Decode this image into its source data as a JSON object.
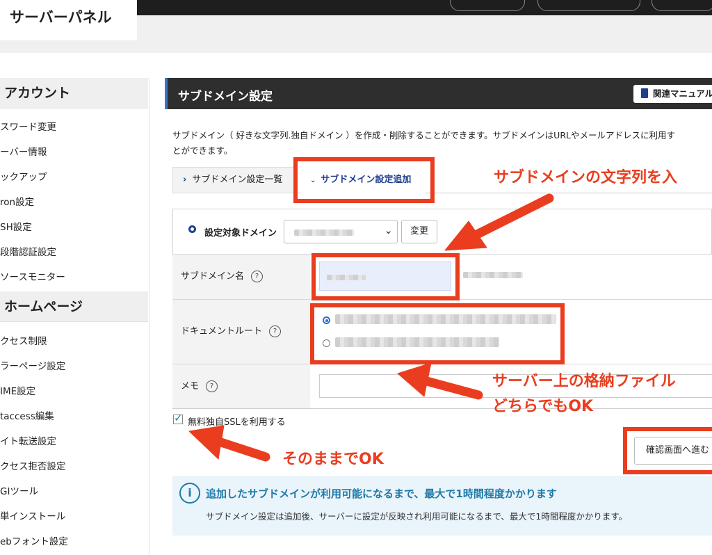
{
  "header": {
    "logo": "サーバーパネル"
  },
  "sidebar": {
    "sections": [
      {
        "title": "アカウント",
        "items": [
          "スワード変更",
          "ーバー情報",
          "ックアップ",
          "ron設定",
          "SH設定",
          "段階認証設定",
          "ソースモニター"
        ]
      },
      {
        "title": "ホームページ",
        "items": [
          "クセス制限",
          "ラーページ設定",
          "IME設定",
          "taccess編集",
          "イト転送設定",
          "クセス拒否設定",
          "GIツール",
          "単インストール",
          "ebフォント設定"
        ]
      }
    ]
  },
  "main": {
    "title": "サブドメイン設定",
    "manual_button": "関連マニュアル",
    "description_line1": "サブドメイン（ 好きな文字列.独自ドメイン ）を作成・削除することができます。サブドメインはURLやメールアドレスに利用す",
    "description_line2": "とができます。",
    "tabs": [
      {
        "label": "サブドメイン設定一覧"
      },
      {
        "label": "サブドメイン設定追加",
        "active": true
      }
    ],
    "form": {
      "target_domain_label": "設定対象ドメイン",
      "change_button": "変更",
      "subdomain_label": "サブドメイン名",
      "docroot_label": "ドキュメントルート",
      "memo_label": "メモ",
      "help_glyph": "?",
      "ssl_label": "無料独自SSLを利用する"
    },
    "confirm_button": "確認画面へ進む",
    "info": {
      "title": "追加したサブドメインが利用可能になるまで、最大で1時間程度かかります",
      "body": "サブドメイン設定は追加後、サーバーに設定が反映され利用可能になるまで、最大で1時間程度かかります。"
    }
  },
  "annotations": {
    "input_hint": "サブドメインの文字列を入",
    "folder_hint_1": "サーバー上の格納ファイル",
    "folder_hint_2": "どちらでもOK",
    "ssl_hint": "そのままでOK"
  },
  "colors": {
    "accent": "#ea3d1f",
    "brand": "#1f3f8f",
    "title_bar": "#2e2e2e"
  }
}
